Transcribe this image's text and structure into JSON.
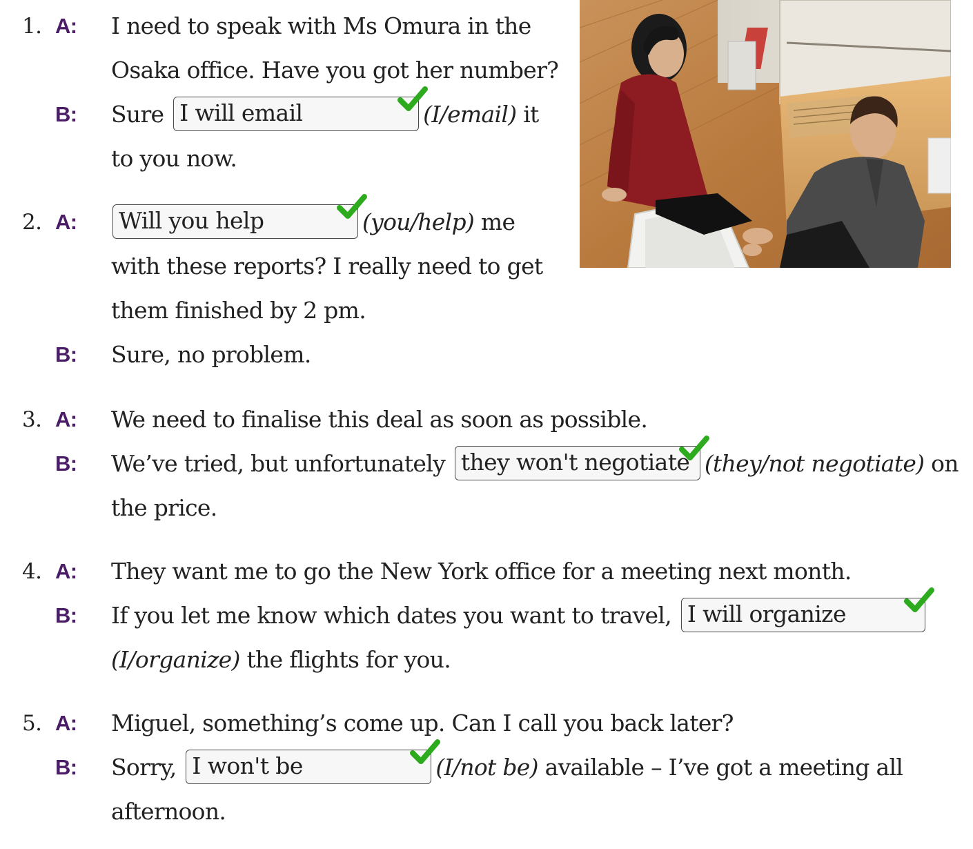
{
  "items": [
    {
      "number": "1.",
      "a_speaker": "A:",
      "a_line1": "I need to speak with Ms Omura in the",
      "a_line2": "Osaka office. Have you got her number?",
      "b_speaker": "B:",
      "b_before": "Sure",
      "b_answer": "I will email",
      "b_hint": "(I/email)",
      "b_after": "it",
      "b_line2": "to you now."
    },
    {
      "number": "2.",
      "a_speaker": "A:",
      "a_answer": "Will you help",
      "a_hint": "(you/help)",
      "a_after": "me",
      "a_line2": "with these reports? I really need to get",
      "a_line3": "them finished by 2 pm.",
      "b_speaker": "B:",
      "b_text": "Sure, no problem."
    },
    {
      "number": "3.",
      "a_speaker": "A:",
      "a_text": "We need to finalise this deal as soon as possible.",
      "b_speaker": "B:",
      "b_before": "We’ve tried, but unfortunately",
      "b_answer": "they won't negotiate",
      "b_hint": "(they/not negotiate)",
      "b_after": "on",
      "b_line2": "the price."
    },
    {
      "number": "4.",
      "a_speaker": "A:",
      "a_text": "They want me to go the New York office for a meeting next month.",
      "b_speaker": "B:",
      "b_before": "If you let me know which dates you want to travel,",
      "b_answer": "I will organize",
      "b_hint": "(I/organize)",
      "b_line2": "the flights for you."
    },
    {
      "number": "5.",
      "a_speaker": "A:",
      "a_text": "Miguel, something’s come up. Can I call you back later?",
      "b_speaker": "B:",
      "b_before": "Sorry,",
      "b_answer": "I won't be",
      "b_hint": "(I/not be)",
      "b_after": "available – I’ve got a meeting all",
      "b_line2": "afternoon."
    }
  ],
  "colors": {
    "speaker": "#4a1d66",
    "check": "#2eaa1e",
    "text": "#222222"
  },
  "icons": {
    "answer_mark": "checkmark-icon"
  }
}
